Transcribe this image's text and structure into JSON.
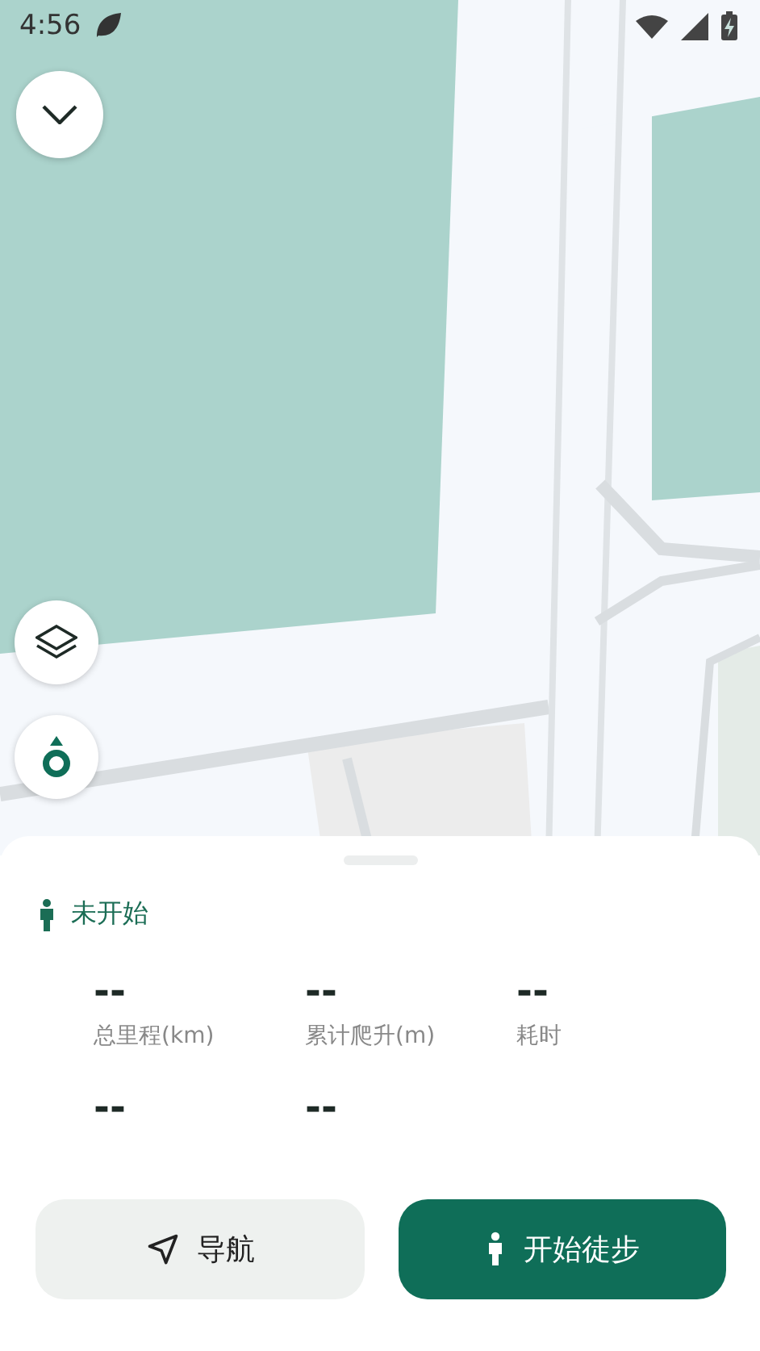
{
  "status_bar": {
    "time": "4:56"
  },
  "sheet": {
    "status": "未开始",
    "stats": [
      {
        "value": "--",
        "label": "总里程(km)"
      },
      {
        "value": "--",
        "label": "累计爬升(m)"
      },
      {
        "value": "--",
        "label": "耗时"
      },
      {
        "value": "--"
      },
      {
        "value": "--"
      }
    ],
    "buttons": [
      {
        "kind": "secondary",
        "label": "导航"
      },
      {
        "kind": "primary",
        "label": "开始徒步"
      }
    ]
  }
}
